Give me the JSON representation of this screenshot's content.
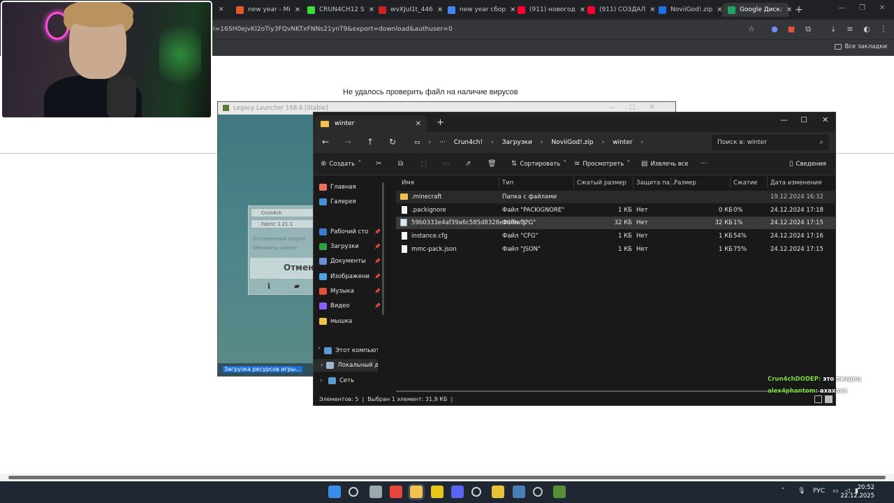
{
  "browser": {
    "tabs": [
      {
        "label": "new year - Mi",
        "color": "#e05a2b"
      },
      {
        "label": "CRUN4CH12 S",
        "color": "#3ddc3d"
      },
      {
        "label": "wvXJuI1t_446",
        "color": "#cc2222"
      },
      {
        "label": "new year сбор",
        "color": "#4285f4"
      },
      {
        "label": "(911) новогод",
        "color": "#ff0033"
      },
      {
        "label": "(911) СОЗДАЛ",
        "color": "#ff0033"
      },
      {
        "label": "NoviiGod!.zip",
        "color": "#1a73e8"
      },
      {
        "label": "Google Диск:",
        "color": "#1fa463"
      }
    ],
    "url": "i=16SH0ejvKI2oTiy3FQvNKTxFNNs21ynT9&export=download&authuser=0",
    "bookmarks_label": "Все закладки",
    "page_message": "Не удалось проверить файл на наличие вирусов"
  },
  "launcher": {
    "title": "Legacy Launcher 168.6 [Stable]",
    "account": "Crun4ch",
    "version": "Fabric 1.21.1",
    "option_delayed": "Отложенный запуск",
    "option_update": "Обновить клиент",
    "cancel_label": "Отмен",
    "status": "Загрузка ресурсов игры..."
  },
  "explorer": {
    "tab_title": "winter",
    "breadcrumb": [
      "Crun4ch!",
      "Загрузки",
      "NoviiGod!.zip",
      "winter"
    ],
    "search_placeholder": "Поиск в: winter",
    "toolbar": {
      "create": "Создать",
      "sort": "Сортировать",
      "view": "Просмотреть",
      "extract": "Извлечь все",
      "details": "Сведения"
    },
    "sidebar": [
      {
        "label": "Главная",
        "color": "#e8735a"
      },
      {
        "label": "Галерея",
        "color": "#4a90d9"
      },
      {
        "label": "Рабочий сто",
        "color": "#3a7bd5"
      },
      {
        "label": "Загрузки",
        "color": "#2ea043"
      },
      {
        "label": "Документы",
        "color": "#6b8fd6"
      },
      {
        "label": "Изображени",
        "color": "#4fa3e0"
      },
      {
        "label": "Музыка",
        "color": "#e0533a"
      },
      {
        "label": "Видео",
        "color": "#8b5cf6"
      },
      {
        "label": "мышка",
        "color": "#f2c14e"
      },
      {
        "label": "Этот компьюте",
        "color": "#5a9bd5"
      },
      {
        "label": "Локальный ди",
        "color": "#9bb7d4"
      },
      {
        "label": "Сеть",
        "color": "#5a9bd5"
      }
    ],
    "columns": [
      "Имя",
      "Тип",
      "Сжатый размер",
      "Защита па...",
      "Размер",
      "Сжатие",
      "Дата изменения"
    ],
    "files": [
      {
        "name": ".minecraft",
        "type": "Папка с файлами",
        "csize": "",
        "prot": "",
        "size": "",
        "ratio": "",
        "date": "19.12.2024 16:32",
        "icon": "folder"
      },
      {
        "name": ".packignore",
        "type": "Файл \"PACKIGNORE\"",
        "csize": "1 КБ",
        "prot": "Нет",
        "size": "0 КБ",
        "ratio": "0%",
        "date": "24.12.2024 17:18",
        "icon": "doc"
      },
      {
        "name": "59b0333e4af39a6c585d8328e30f9a0...",
        "type": "Файл \"JPG\"",
        "csize": "32 КБ",
        "prot": "Нет",
        "size": "32 КБ",
        "ratio": "1%",
        "date": "24.12.2024 17:15",
        "icon": "img"
      },
      {
        "name": "instance.cfg",
        "type": "Файл \"CFG\"",
        "csize": "1 КБ",
        "prot": "Нет",
        "size": "1 КБ",
        "ratio": "54%",
        "date": "24.12.2024 17:16",
        "icon": "doc"
      },
      {
        "name": "mmc-pack.json",
        "type": "Файл \"JSON\"",
        "csize": "1 КБ",
        "prot": "Нет",
        "size": "1 КБ",
        "ratio": "75%",
        "date": "24.12.2024 17:15",
        "icon": "doc"
      }
    ],
    "status_count": "Элементов: 5",
    "status_selected": "Выбран 1 элемент: 31,9 КБ"
  },
  "chat": [
    {
      "user": "Crun4chDODEP:",
      "msg": "это пиздец"
    },
    {
      "user": "alex4phantom:",
      "msg": "ахахаха"
    }
  ],
  "taskbar": {
    "apps": [
      {
        "name": "start-icon",
        "color": "#3a8ee6"
      },
      {
        "name": "search-icon",
        "color": "#d0d0d0"
      },
      {
        "name": "task-view-icon",
        "color": "#9aa"
      },
      {
        "name": "chrome-icon",
        "color": "#e8453c"
      },
      {
        "name": "explorer-icon",
        "color": "#f2c14e"
      },
      {
        "name": "app-yellow-icon",
        "color": "#e6c619"
      },
      {
        "name": "discord-icon",
        "color": "#5865f2"
      },
      {
        "name": "obs-icon",
        "color": "#d0d0d0"
      },
      {
        "name": "app-star-icon",
        "color": "#e8c33a"
      },
      {
        "name": "steam-icon",
        "color": "#4a7fb5"
      },
      {
        "name": "settings-icon",
        "color": "#c0c0c0"
      },
      {
        "name": "minecraft-icon",
        "color": "#5a8f3a"
      }
    ],
    "lang": "РУС",
    "time": "20:52",
    "date": "22.12.2025"
  }
}
